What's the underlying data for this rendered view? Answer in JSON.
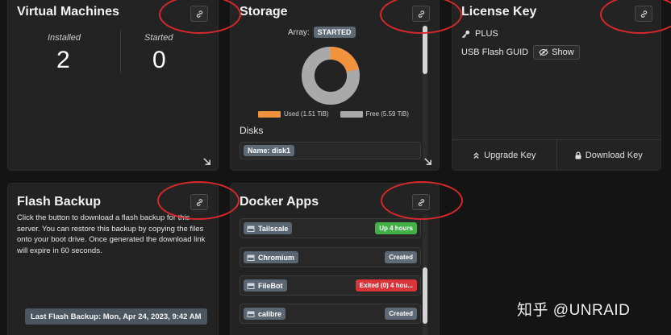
{
  "colors": {
    "background": "#141414",
    "card": "#232323",
    "used": "#f0923e",
    "free": "#a9a9a9",
    "badge_gray": "#5f6a77",
    "badge_green": "#43b047",
    "badge_red": "#d8343a",
    "annotation_ring": "#d9282b"
  },
  "vm": {
    "title": "Virtual Machines",
    "installed_label": "Installed",
    "installed_count": "2",
    "started_label": "Started",
    "started_count": "0",
    "link_icon": "link-icon",
    "expand_icon": "arrow-down-right-icon"
  },
  "storage": {
    "title": "Storage",
    "array_label": "Array:",
    "array_status": "STARTED",
    "used_legend": "Used (1.51 TiB)",
    "free_legend": "Free (5.59 TiB)",
    "used_tib": 1.51,
    "free_tib": 5.59,
    "disks_heading": "Disks",
    "disk_name": "Name: disk1",
    "link_icon": "link-icon",
    "expand_icon": "arrow-down-right-icon"
  },
  "license": {
    "title": "License Key",
    "key_type": "PLUS",
    "key_icon": "key-icon",
    "guid_label": "USB Flash GUID",
    "show_label": "Show",
    "show_icon": "eye-slash-icon",
    "upgrade_label": "Upgrade Key",
    "upgrade_icon": "chevron-double-up-icon",
    "download_label": "Download Key",
    "download_icon": "lock-icon",
    "link_icon": "link-icon"
  },
  "flash": {
    "title": "Flash Backup",
    "description": "Click the button to download a flash backup for this server. You can restore this backup by copying the files onto your boot drive. Once generated the download link will expire in 60 seconds.",
    "last_backup": "Last Flash Backup: Mon, Apr 24, 2023, 9:42 AM",
    "link_icon": "link-icon"
  },
  "docker": {
    "title": "Docker Apps",
    "link_icon": "link-icon",
    "app_icon": "container-icon",
    "apps": [
      {
        "name": "Tailscale",
        "status": "Up 4 hours",
        "status_kind": "green"
      },
      {
        "name": "Chromium",
        "status": "Created",
        "status_kind": "gray"
      },
      {
        "name": "FileBot",
        "status": "Exited (0) 4 hou...",
        "status_kind": "red"
      },
      {
        "name": "calibre",
        "status": "Created",
        "status_kind": "gray"
      }
    ]
  },
  "watermark": "知乎 @UNRAID"
}
